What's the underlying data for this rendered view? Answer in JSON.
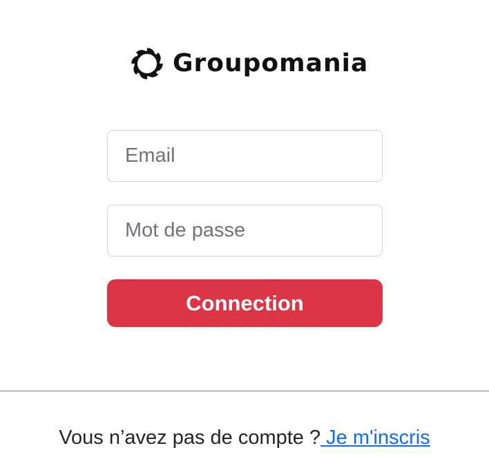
{
  "brand": {
    "name": "Groupomania",
    "icon": "groupomania-logo-icon"
  },
  "login_form": {
    "email_placeholder": "Email",
    "email_value": "",
    "password_placeholder": "Mot de passe",
    "password_value": "",
    "submit_label": "Connection",
    "submit_color": "#dc3545"
  },
  "signup_prompt": {
    "text": "Vous n’avez pas de compte ?",
    "link_label": " Je m'inscris",
    "link_color": "#0d6efd"
  }
}
